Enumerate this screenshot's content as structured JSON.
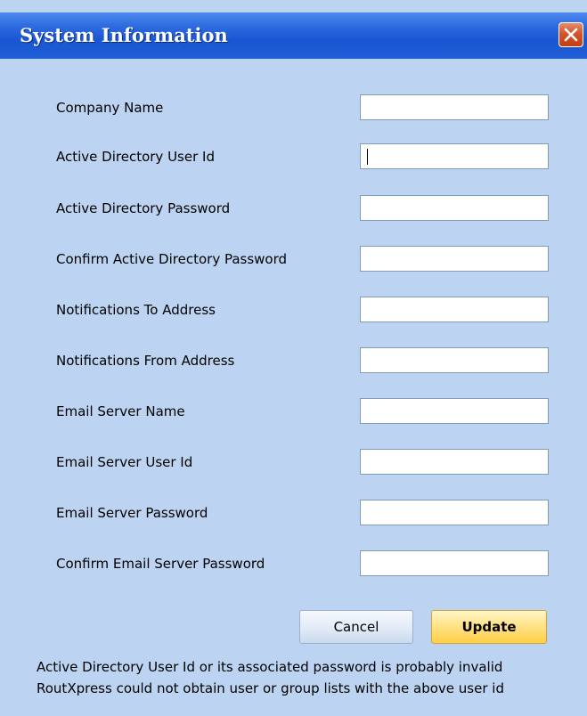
{
  "window": {
    "title": "System Information",
    "close_glyph": "close-icon"
  },
  "fields": [
    {
      "label": "Company Name",
      "value": ""
    },
    {
      "label": "Active Directory User Id",
      "value": ""
    },
    {
      "label": "Active Directory Password",
      "value": ""
    },
    {
      "label": "Confirm Active Directory Password",
      "value": ""
    },
    {
      "label": "Notifications To Address",
      "value": ""
    },
    {
      "label": "Notifications From Address",
      "value": ""
    },
    {
      "label": "Email Server Name",
      "value": ""
    },
    {
      "label": "Email Server User Id",
      "value": ""
    },
    {
      "label": "Email Server Password",
      "value": ""
    },
    {
      "label": "Confirm Email Server Password",
      "value": ""
    }
  ],
  "buttons": {
    "cancel_label": "Cancel",
    "update_label": "Update"
  },
  "messages": [
    "Active Directory User Id or its associated password is probably invalid",
    "RoutXpress could not obtain user or group lists with the above user id"
  ],
  "colors": {
    "titlebar": "#1e5fd8",
    "body_background": "#bcd4f2",
    "close_button": "#d3552d",
    "update_button": "#ffcf47"
  }
}
